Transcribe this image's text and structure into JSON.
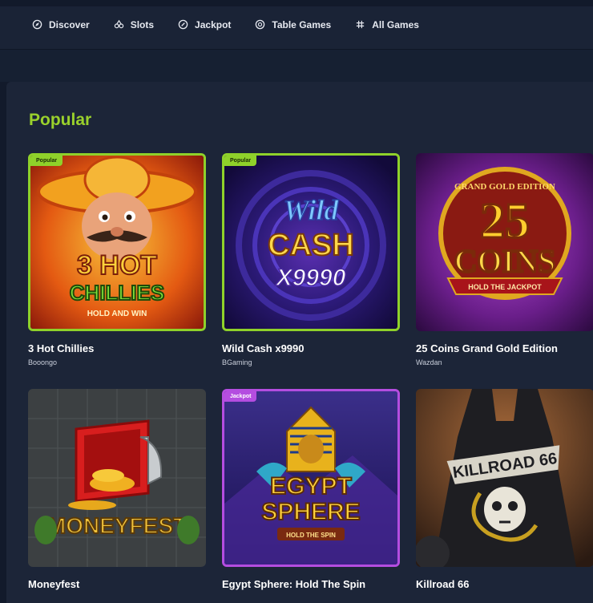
{
  "nav": {
    "items": [
      {
        "label": "Discover",
        "icon": "compass-icon"
      },
      {
        "label": "Slots",
        "icon": "slots-icon"
      },
      {
        "label": "Jackpot",
        "icon": "jackpot-icon"
      },
      {
        "label": "Table Games",
        "icon": "chip-icon"
      },
      {
        "label": "All Games",
        "icon": "grid-icon"
      }
    ]
  },
  "section": {
    "title": "Popular"
  },
  "games": [
    {
      "title": "3 Hot Chillies",
      "provider": "Booongo",
      "tag": "Popular",
      "art_text_1": "3 HOT",
      "art_text_2": "CHILLIES",
      "art_text_3": "HOLD AND WIN"
    },
    {
      "title": "Wild Cash x9990",
      "provider": "BGaming",
      "tag": "Popular",
      "art_text_1": "Wild",
      "art_text_2": "CASH",
      "art_text_3": "X9990"
    },
    {
      "title": "25 Coins Grand Gold Edition",
      "provider": "Wazdan",
      "art_text_1": "GRAND GOLD EDITION",
      "art_text_2": "25",
      "art_text_3": "COINS",
      "art_text_4": "HOLD THE JACKPOT"
    },
    {
      "title": "Moneyfest",
      "provider": "",
      "art_text_1": "MONEYFEST"
    },
    {
      "title": "Egypt Sphere: Hold The Spin",
      "provider": "",
      "tag": "Jackpot",
      "art_text_1": "EGYPT",
      "art_text_2": "SPHERE",
      "art_text_3": "HOLD THE SPIN"
    },
    {
      "title": "Killroad 66",
      "provider": "",
      "art_text_1": "KILLROAD 66"
    }
  ],
  "colors": {
    "accent": "#9ad12c",
    "jackpot": "#b44de0",
    "background": "#121a2b",
    "panel": "#1c2538"
  }
}
